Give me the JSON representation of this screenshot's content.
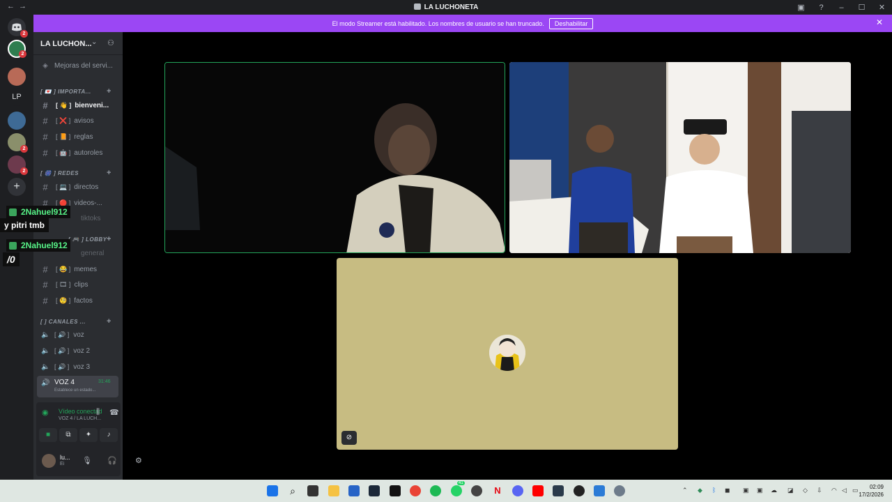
{
  "window": {
    "title": "LA LUCHONETA"
  },
  "banner": {
    "text": "El modo Streamer está habilitado. Los nombres de usuario se han truncado.",
    "button_label": "Deshabilitar"
  },
  "server_rail": {
    "badges": [
      "2",
      "2",
      "2",
      "2"
    ],
    "lp_label": "LP"
  },
  "sidebar": {
    "server_name": "LA LUCHON...",
    "boost_label": "Mejoras del servi...",
    "categories": [
      {
        "label": "[ 💌 ] IMPORTA..."
      },
      {
        "label": "[ 🎆 ] REDES"
      },
      {
        "label": "[ 🎮 ] LOBBY"
      },
      {
        "label": "[ ] CANALES ..."
      }
    ],
    "channels": [
      {
        "emoji": "[ 👋 ]",
        "name": "bienveni..."
      },
      {
        "emoji": "[ ❌ ]",
        "name": "avisos"
      },
      {
        "emoji": "[ 📙 ]",
        "name": "reglas"
      },
      {
        "emoji": "[ 🤖 ]",
        "name": "autoroles"
      },
      {
        "emoji": "[ 💻 ]",
        "name": "directos"
      },
      {
        "emoji": "[ 🔴 ]",
        "name": "videos-..."
      },
      {
        "emoji": "",
        "name": "tiktoks"
      },
      {
        "emoji": "",
        "name": "general"
      },
      {
        "emoji": "[ 😂 ]",
        "name": "memes"
      },
      {
        "emoji": "[ 🎞 ]",
        "name": "clips"
      },
      {
        "emoji": "[ 🧐 ]",
        "name": "factos"
      }
    ],
    "voice_channels": [
      {
        "emoji": "[ 🔊 ]",
        "name": "voz"
      },
      {
        "emoji": "[ 🔊 ]",
        "name": "voz 2"
      },
      {
        "emoji": "[ 🔊 ]",
        "name": "voz 3"
      }
    ],
    "active_voice": {
      "name": "VOZ 4",
      "timer": "31:46",
      "status": "Establece un estado..."
    }
  },
  "voice_panel": {
    "status": "Vídeo conectad",
    "location": "VOZ 4 / LA LUCH...",
    "user_name": "lu...",
    "user_status": "Ei"
  },
  "overlay": {
    "user1": "2Nahuel912",
    "message": "y pitri tmb",
    "user2": "2Nahuel912",
    "typing": "/0"
  },
  "taskbar": {
    "time": "02:09",
    "date": "17/2/2026",
    "whatsapp_badge": "41"
  },
  "colors": {
    "accent": "#9b47f4",
    "speaking": "#23a55a",
    "tile3_bg": "#c7bc82"
  }
}
